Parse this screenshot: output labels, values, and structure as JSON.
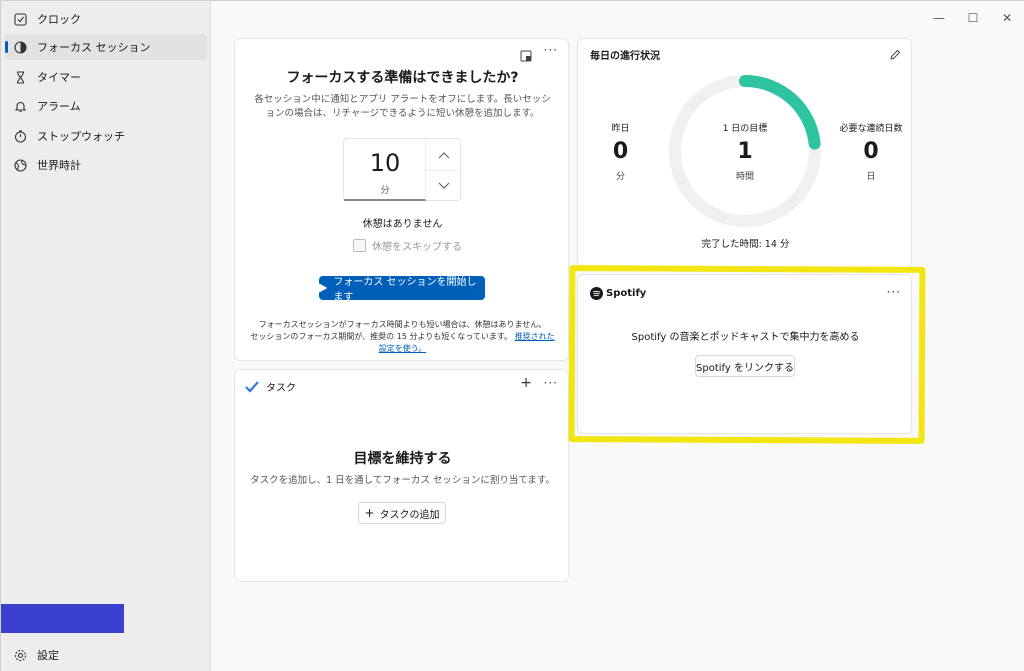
{
  "sidebar": {
    "items": [
      {
        "label": "クロック",
        "icon": "clock-icon"
      },
      {
        "label": "フォーカス セッション",
        "icon": "focus-icon"
      },
      {
        "label": "タイマー",
        "icon": "hourglass-icon"
      },
      {
        "label": "アラーム",
        "icon": "bell-icon"
      },
      {
        "label": "ストップウォッチ",
        "icon": "stopwatch-icon"
      },
      {
        "label": "世界時計",
        "icon": "globe-icon"
      }
    ],
    "settings_label": "設定"
  },
  "focus": {
    "title": "フォーカスする準備はできましたか?",
    "description": "各セッション中に通知とアプリ アラートをオフにします。長いセッションの場合は、リチャージできるように短い休憩を追加します。",
    "minutes_value": "10",
    "minutes_unit": "分",
    "break_status": "休憩はありません",
    "skip_break_label": "休憩をスキップする",
    "start_button": "フォーカス セッションを開始します",
    "note_line1": "フォーカスセッションがフォーカス時間よりも短い場合は、休憩はありません。",
    "note_line2": "セッションのフォーカス期間が、推奨の 15 分よりも短くなっています。",
    "note_link": "推奨された設定を使う。"
  },
  "daily": {
    "title": "毎日の進行状況",
    "yesterday_label": "昨日",
    "yesterday_value": "0",
    "yesterday_unit": "分",
    "goal_label": "1 日の目標",
    "goal_value": "1",
    "goal_unit": "時間",
    "streak_label": "必要な連続日数",
    "streak_value": "0",
    "streak_unit": "日",
    "completed": "完了した時間: 14 分",
    "progress_fraction": 0.233,
    "accent": "#2ec4a0"
  },
  "spotify": {
    "brand": "Spotify",
    "description": "Spotify の音楽とポッドキャストで集中力を高める",
    "link_button": "Spotify をリンクする"
  },
  "tasks": {
    "title": "タスク",
    "heading": "目標を維持する",
    "description": "タスクを追加し、1 日を通してフォーカス セッションに割り当てます。",
    "add_button": "タスクの追加"
  },
  "colors": {
    "accent_blue": "#005fb8",
    "highlight_yellow": "#f2e512",
    "sidebar_block": "#3b41cf"
  }
}
